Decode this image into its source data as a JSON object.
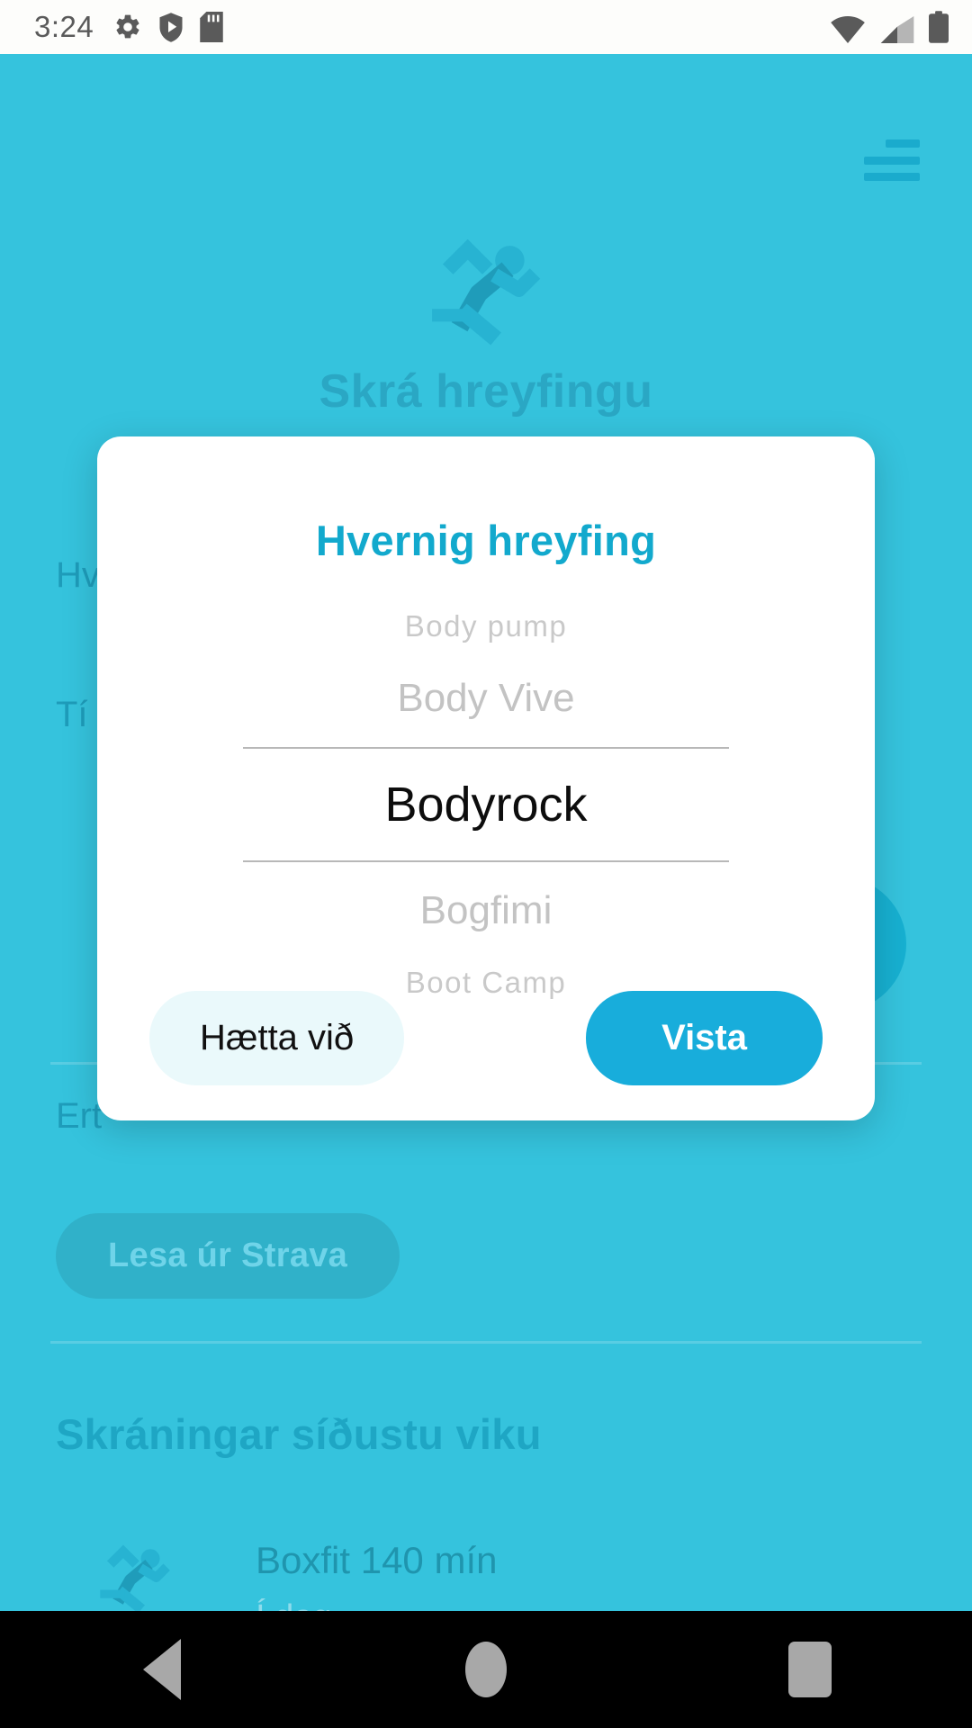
{
  "status_bar": {
    "time": "3:24",
    "left_icons": [
      "gear-icon",
      "play-protect-icon",
      "sd-card-icon"
    ],
    "right_icons": [
      "wifi-icon",
      "cellular-signal-icon",
      "battery-icon"
    ]
  },
  "app": {
    "menu_icon": "hamburger-menu-icon",
    "hero_icon": "running-person-icon",
    "hero_title": "Skrá hreyfingu",
    "obscured_labels": [
      "Hv",
      "Tí",
      "Ert"
    ],
    "strava_button": "Lesa úr Strava",
    "section_title": "Skráningar síðustu viku",
    "entries": [
      {
        "icon": "running-person-icon",
        "title": "Boxfit 140 mín",
        "subtitle": "Í dag"
      }
    ]
  },
  "dialog": {
    "title": "Hvernig hreyfing",
    "picker": {
      "options": [
        "Body pump",
        "Body Vive",
        "Bodyrock",
        "Bogfimi",
        "Boot Camp"
      ],
      "selected": "Bodyrock",
      "selected_index": 2
    },
    "cancel_label": "Hætta við",
    "save_label": "Vista"
  },
  "nav_bar": {
    "back": "back-triangle-icon",
    "home": "home-circle-icon",
    "recents": "recents-square-icon"
  },
  "colors": {
    "background": "#35c3dd",
    "accent": "#12a9cd",
    "save_button": "#18addb",
    "cancel_button": "#eaf9fb",
    "dialog_surface": "#ffffff",
    "status_bar": "#fdfdfb",
    "nav_bar": "#000000"
  }
}
